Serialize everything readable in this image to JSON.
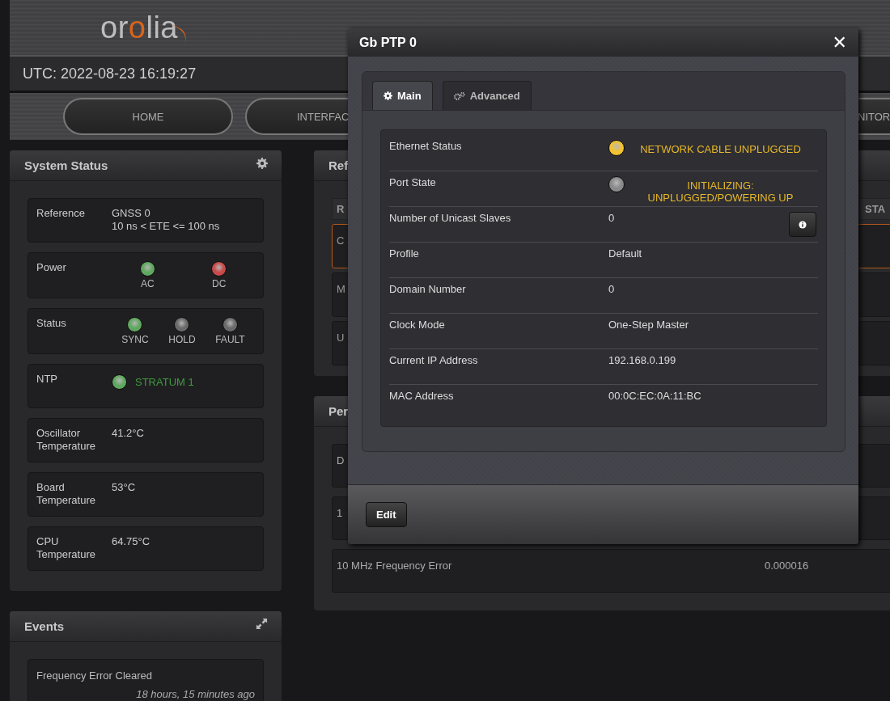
{
  "header": {
    "logo": [
      {
        "text": "or",
        "accent": false
      },
      {
        "text": "o",
        "accent": true
      },
      {
        "text": "lia",
        "accent": false
      }
    ],
    "utc": "UTC: 2022-08-23 16:19:27",
    "nav": [
      {
        "label": "HOME",
        "kind": "full"
      },
      {
        "label": "INTERFAC",
        "kind": "full"
      },
      {
        "label": "NITOR",
        "kind": "edge"
      }
    ]
  },
  "system_status": {
    "title": "System Status",
    "rows": [
      {
        "kind": "text",
        "label": "Reference",
        "values": [
          "GNSS 0",
          "10 ns < ETE <= 100 ns"
        ]
      },
      {
        "kind": "lights",
        "label": "Power",
        "lights": [
          {
            "label": "AC",
            "color": "#5fa85f"
          },
          {
            "label": "DC",
            "color": "#c84a4a"
          }
        ]
      },
      {
        "kind": "lights",
        "label": "Status",
        "lights": [
          {
            "label": "SYNC",
            "color": "#5fa85f"
          },
          {
            "label": "HOLD",
            "color": "#6a6a6a"
          },
          {
            "label": "FAULT",
            "color": "#6a6a6a"
          }
        ]
      },
      {
        "kind": "indicator",
        "label": "NTP",
        "color": "#5fa85f",
        "values": [
          "STRATUM 1"
        ]
      },
      {
        "kind": "text",
        "label": "Oscillator Temperature",
        "values": [
          "41.2°C"
        ]
      },
      {
        "kind": "text",
        "label": "Board Temperature",
        "values": [
          "53°C"
        ]
      },
      {
        "kind": "text",
        "label": "CPU Temperature",
        "values": [
          "64.75°C"
        ]
      }
    ]
  },
  "events": {
    "title": "Events",
    "items": [
      {
        "message": "Frequency Error Cleared",
        "time": "18 hours, 15 minutes ago"
      }
    ]
  },
  "reference_panel": {
    "title": "Ref",
    "columns": [
      "R",
      "STA"
    ],
    "rows": [
      {
        "cell": "C",
        "selected": true
      },
      {
        "cell": "M",
        "selected": false
      },
      {
        "cell": "U",
        "selected": false
      }
    ]
  },
  "performance_panel": {
    "title": "Per",
    "rows": [
      {
        "label": "D"
      },
      {
        "label": "1"
      },
      {
        "label": "10 MHz Frequency Error",
        "value": "0.000016"
      }
    ]
  },
  "dialog": {
    "title": "Gb PTP 0",
    "close": "✕",
    "tabs": [
      {
        "label": "Main",
        "selected": true
      },
      {
        "label": "Advanced",
        "selected": false
      }
    ],
    "rows": [
      {
        "kind": "status",
        "label": "Ethernet Status",
        "color": "#f2c230",
        "value": "NETWORK CABLE UNPLUGGED"
      },
      {
        "kind": "status",
        "label": "Port State",
        "color": "#8a8a8a",
        "value": "INITIALIZING: UNPLUGGED/POWERING UP"
      },
      {
        "kind": "info",
        "label": "Number of Unicast Slaves",
        "value": "0"
      },
      {
        "kind": "value",
        "label": "Profile",
        "value": "Default"
      },
      {
        "kind": "value",
        "label": "Domain Number",
        "value": "0"
      },
      {
        "kind": "value",
        "label": "Clock Mode",
        "value": "One-Step Master"
      },
      {
        "kind": "value",
        "label": "Current IP Address",
        "value": "192.168.0.199"
      },
      {
        "kind": "value",
        "label": "MAC Address",
        "value": "00:0C:EC:0A:11:BC"
      }
    ],
    "buttons": [
      "Edit"
    ]
  }
}
